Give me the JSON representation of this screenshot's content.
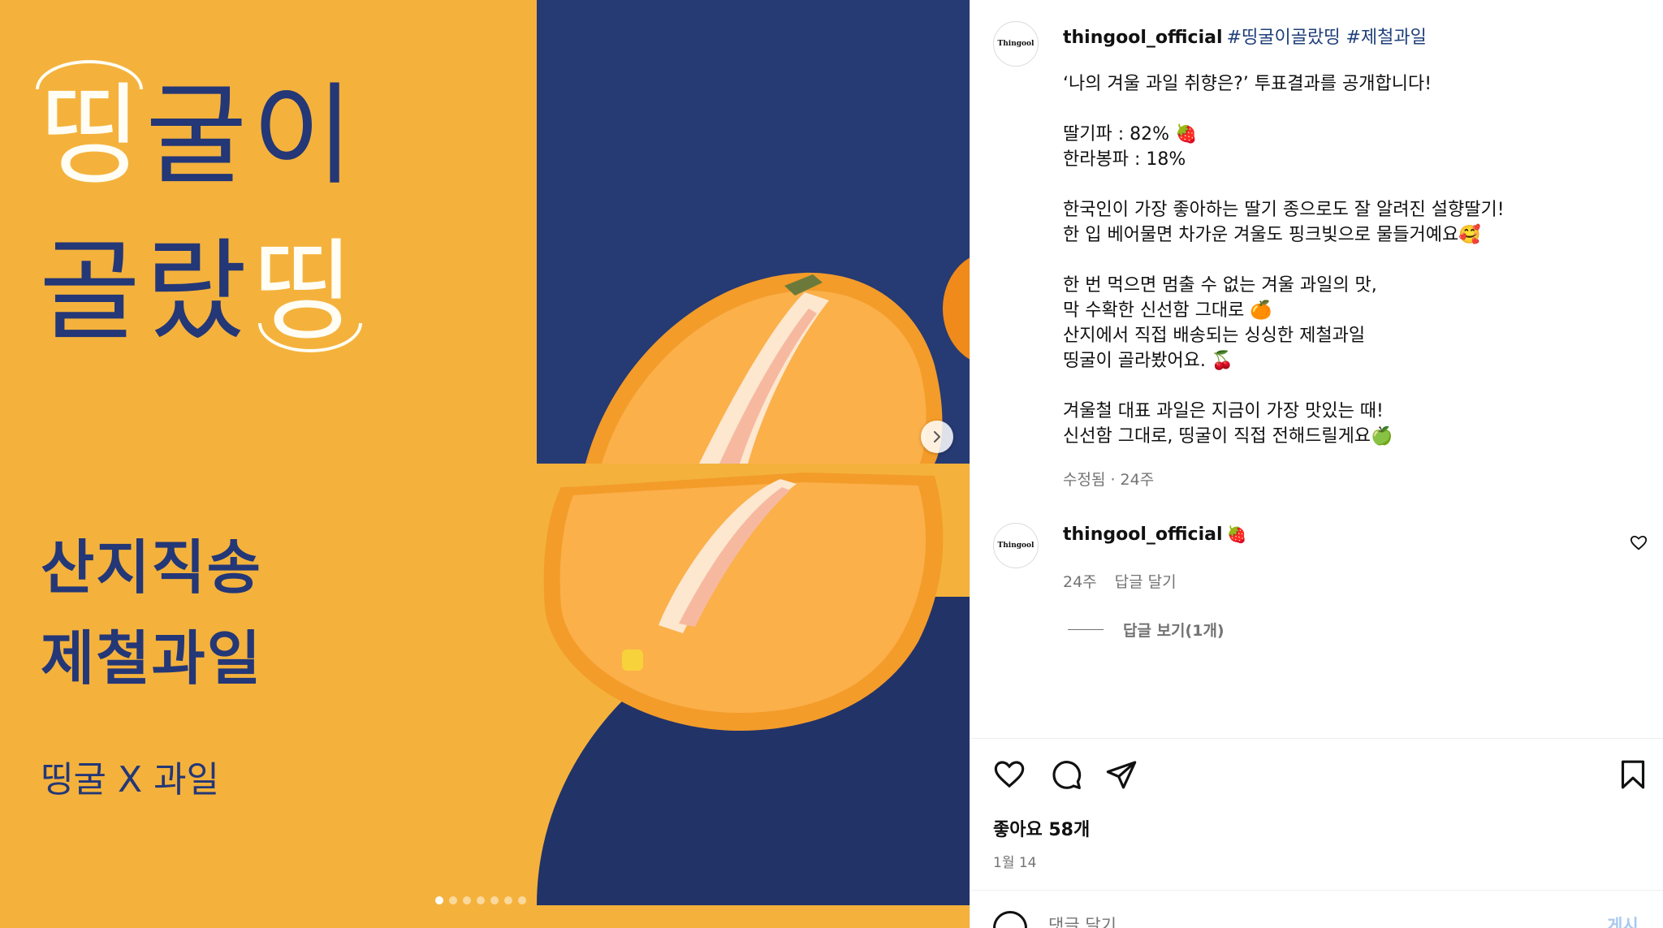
{
  "media": {
    "title_line1_hl": "띵",
    "title_line1_rest": "굴이",
    "title_line2_rest": "골랐",
    "title_line2_hl": "띵",
    "subtitle_line1": "산지직송",
    "subtitle_line2": "제철과일",
    "brand_line": "띵굴 X 과일",
    "carousel": {
      "total": 7,
      "active_index": 0
    },
    "next_icon": "chevron-right-icon"
  },
  "post": {
    "avatar_text": "Thingool",
    "username": "thingool_official",
    "hashtags": "#띵굴이골랐띵 #제철과일",
    "caption": "‘나의 겨울 과일 취향은?’ 투표결과를 공개합니다!\n\n딸기파 : 82% 🍓\n한라봉파 : 18%\n\n한국인이 가장 좋아하는 딸기 종으로도 잘 알려진 설향딸기!\n한 입 베어물면 차가운 겨울도 핑크빛으로 물들거예요🥰\n\n한 번 먹으면 멈출 수 없는 겨울 과일의 맛,\n막 수확한 신선함 그대로 🍊\n산지에서 직접 배송되는 싱싱한 제철과일\n띵굴이 골라봤어요. 🍒\n\n겨울철 대표 과일은 지금이 가장 맛있는 때!\n신선함 그대로, 띵굴이 직접 전해드릴게요🍏",
    "caption_meta": "수정됨 · 24주"
  },
  "comment": {
    "avatar_text": "Thingool",
    "username": "thingool_official",
    "text": "🍓",
    "age": "24주",
    "reply_label": "답글 달기",
    "view_replies": "답글 보기(1개)"
  },
  "actions": {
    "likes": "좋아요 58개",
    "date": "1월 14",
    "comment_placeholder": "댓글 달기...",
    "post_label": "게시"
  },
  "colors": {
    "background_yellow": "#f4b23c",
    "navy": "#243777",
    "hashtag": "#1f3f7a",
    "meta_gray": "#737373"
  }
}
